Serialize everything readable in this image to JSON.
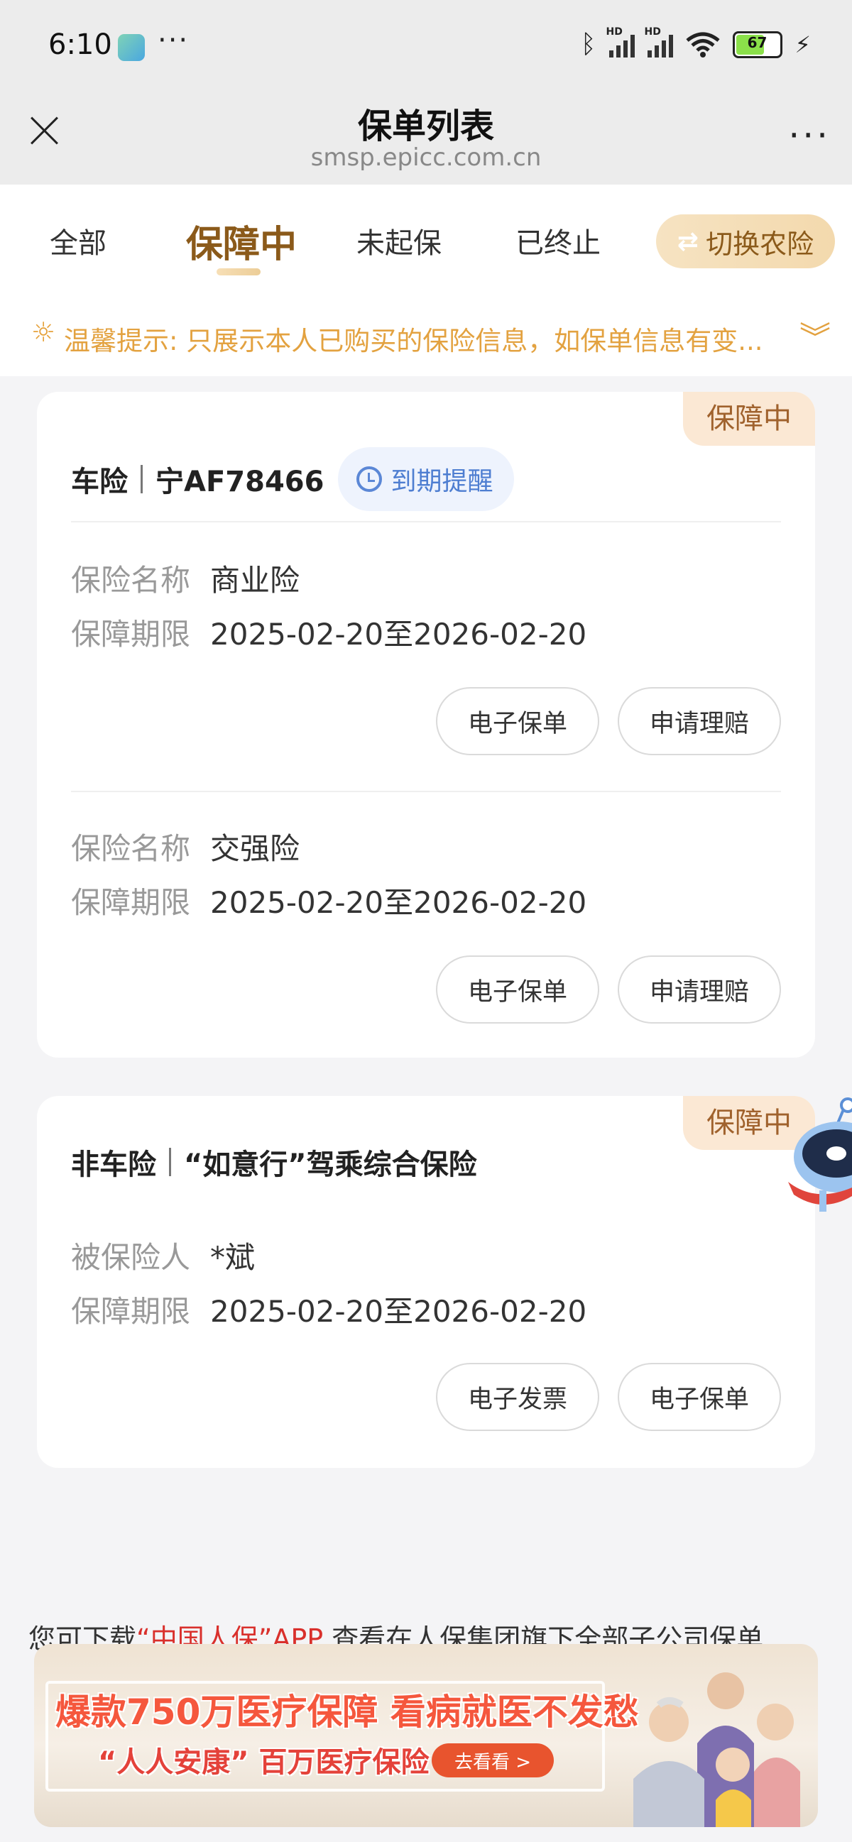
{
  "status_bar": {
    "time": "6:10",
    "dots": "···",
    "battery": "67",
    "signal_1_label": "HD",
    "signal_2_label": "HD"
  },
  "header": {
    "title": "保单列表",
    "url": "smsp.epicc.com.cn",
    "more": "···"
  },
  "tabs": [
    {
      "label": "全部",
      "active": false
    },
    {
      "label": "保障中",
      "active": true
    },
    {
      "label": "未起保",
      "active": false
    },
    {
      "label": "已终止",
      "active": false
    }
  ],
  "switch_button": {
    "label": "切换农险"
  },
  "tip": {
    "text": "温馨提示: 只展示本人已购买的保险信息，如保单信息有变..."
  },
  "cards": [
    {
      "status": "保障中",
      "type": "车险",
      "title": "宁AF78466",
      "remind_label": "到期提醒",
      "policies": [
        {
          "name_label": "保险名称",
          "name": "商业险",
          "period_label": "保障期限",
          "period": "2025-02-20至2026-02-20",
          "buttons": [
            "电子保单",
            "申请理赔"
          ]
        },
        {
          "name_label": "保险名称",
          "name": "交强险",
          "period_label": "保障期限",
          "period": "2025-02-20至2026-02-20",
          "buttons": [
            "电子保单",
            "申请理赔"
          ]
        }
      ]
    },
    {
      "status": "保障中",
      "type": "非车险",
      "title": "“如意行”驾乘综合保险",
      "insured_label": "被保险人",
      "insured": "*斌",
      "period_label": "保障期限",
      "period": "2025-02-20至2026-02-20",
      "buttons": [
        "电子发票",
        "电子保单"
      ]
    }
  ],
  "footer": {
    "prefix": "您可下载",
    "app_name": "“中国人保”APP",
    "suffix": " 查看在人保集团旗下全部子公司保单"
  },
  "banner": {
    "line1": "爆款750万医疗保障 看病就医不发愁",
    "line2": "“人人安康” 百万医疗保险",
    "cta": "去看看 >"
  },
  "colors": {
    "accent_brown": "#8b5a1a",
    "tip_orange": "#e3a240",
    "badge_bg": "#fbe8d4",
    "remind_blue": "#4e7ed1",
    "red": "#d9302c"
  }
}
